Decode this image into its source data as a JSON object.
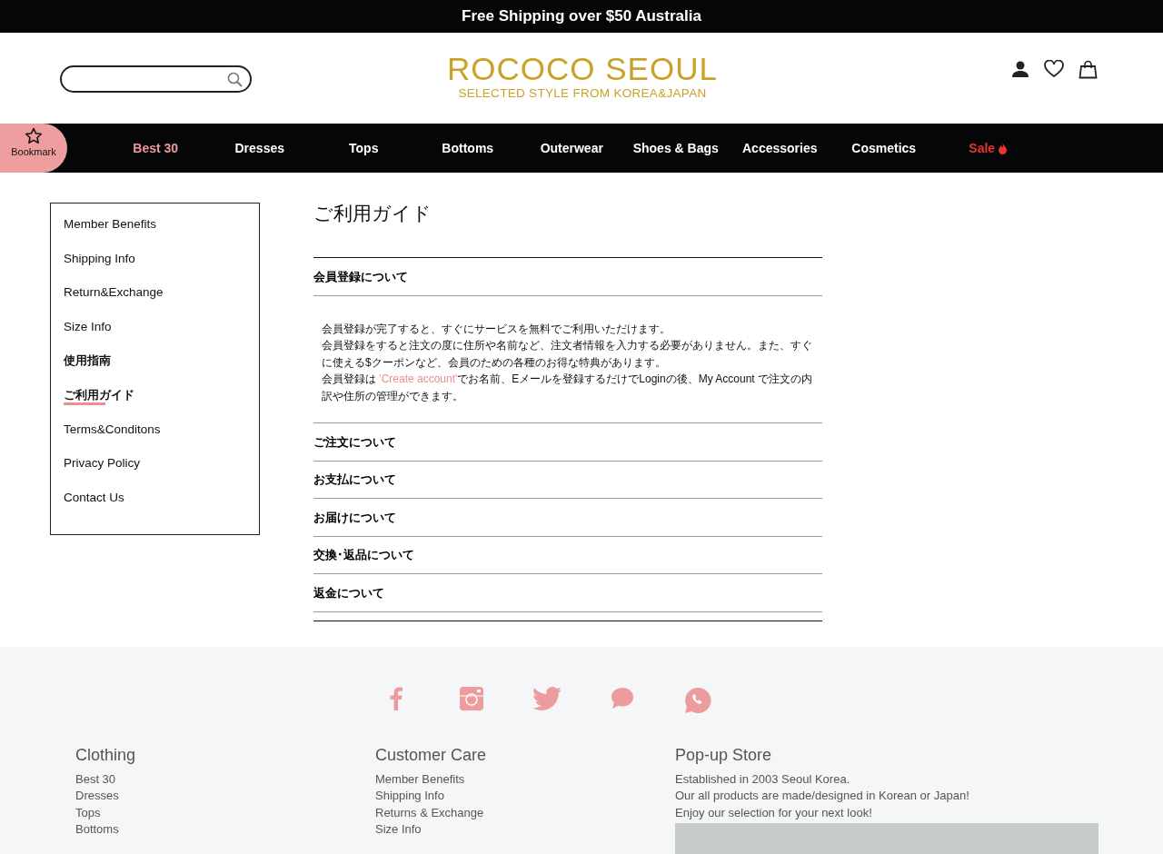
{
  "announcement": "Free Shipping over $50 Australia",
  "header": {
    "logo": {
      "title": "ROCOCO SEOUL",
      "tagline": "SELECTED STYLE FROM KOREA&JAPAN"
    }
  },
  "bookmark": {
    "label": "Bookmark"
  },
  "nav": [
    {
      "label": "Best 30",
      "color": "#f19a9a",
      "kind": "plain"
    },
    {
      "label": "Dresses",
      "color": "#ffffff",
      "kind": "plain"
    },
    {
      "label": "Tops",
      "color": "#ffffff",
      "kind": "plain"
    },
    {
      "label": "Bottoms",
      "color": "#ffffff",
      "kind": "plain"
    },
    {
      "label": "Outerwear",
      "color": "#ffffff",
      "kind": "plain"
    },
    {
      "label": "Shoes & Bags",
      "color": "#ffffff",
      "kind": "plain"
    },
    {
      "label": "Accessories",
      "color": "#ffffff",
      "kind": "plain"
    },
    {
      "label": "Cosmetics",
      "color": "#ffffff",
      "kind": "plain"
    },
    {
      "label": "Sale",
      "color": "#e8342c",
      "kind": "hot"
    }
  ],
  "sidebar": {
    "items": [
      {
        "label": "Member Benefits",
        "kind": "link",
        "selected": false
      },
      {
        "label": "Shipping Info",
        "kind": "link",
        "selected": false
      },
      {
        "label": "Return&Exchange",
        "kind": "link",
        "selected": false
      },
      {
        "label": "Size Info",
        "kind": "link",
        "selected": false
      },
      {
        "label": "使用指南",
        "kind": "heading",
        "selected": false
      },
      {
        "label": "ご利用ガイド",
        "kind": "link",
        "selected": true
      },
      {
        "label": "Terms&Conditons",
        "kind": "link",
        "selected": false
      },
      {
        "label": "Privacy Policy",
        "kind": "link",
        "selected": false
      },
      {
        "label": "Contact Us",
        "kind": "link",
        "selected": false
      }
    ]
  },
  "page_title": "ご利用ガイド",
  "sections": [
    {
      "title": "会員登録について",
      "expanded": true,
      "body": [
        {
          "text": "会員登録が完了すると、すぐにサービスを無料でご利用いただけます。"
        },
        {
          "text": "会員登録をすると注文の度に住所や名前など、注文者情報を入力する必要がありません。また、すぐに使える$クーポンなど、会員のための各種のお得な特典があります。"
        },
        {
          "text": "会員登録は ",
          "link": "'Create account'",
          "after": "でお名前、Eメールを登録するだけでLoginの後、My Account で注文の内訳や住所の管理ができます。"
        }
      ]
    },
    {
      "title": "ご注文について",
      "expanded": false
    },
    {
      "title": "お支払について",
      "expanded": false
    },
    {
      "title": "お届けについて",
      "expanded": false
    },
    {
      "title": "交換･返品について",
      "expanded": false
    },
    {
      "title": "返金について",
      "expanded": false
    }
  ],
  "footer": {
    "social": [
      {
        "kind": "facebook"
      },
      {
        "kind": "instagram"
      },
      {
        "kind": "twitter"
      },
      {
        "kind": "chat"
      },
      {
        "kind": "whatsapp"
      }
    ],
    "columns": [
      {
        "kind": "links",
        "title": "Clothing",
        "items": [
          "Best 30",
          "Dresses",
          "Tops",
          "Bottoms"
        ]
      },
      {
        "kind": "links",
        "title": "Customer Care",
        "items": [
          "Member Benefits",
          "Shipping Info",
          "Returns & Exchange",
          "Size Info"
        ]
      },
      {
        "kind": "store",
        "title": "Pop-up Store",
        "lines": [
          "Established in 2003 Seoul Korea.",
          "Our all products are made/designed in Korean or Japan!",
          "Enjoy our selection for your next look!"
        ]
      }
    ]
  }
}
